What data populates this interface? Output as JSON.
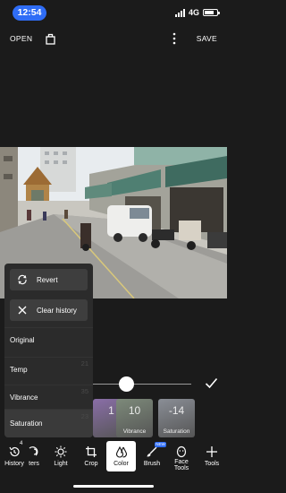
{
  "status_bar": {
    "time": "12:54",
    "network": "4G",
    "battery_level": 0.75
  },
  "top_bar": {
    "open_label": "OPEN",
    "save_label": "SAVE",
    "share_icon": "share-icon",
    "more_icon": "more-vertical-icon"
  },
  "photo": {
    "subject": "street-scene-photo"
  },
  "history_panel": {
    "revert_label": "Revert",
    "clear_label": "Clear history",
    "items": [
      {
        "label": "Original",
        "num": ""
      },
      {
        "label": "Temp",
        "num": "21"
      },
      {
        "label": "Vibrance",
        "num": "35"
      },
      {
        "label": "Saturation",
        "num": "23"
      }
    ],
    "selected_item": "Saturation"
  },
  "adjustment_slider": {
    "level": 0.34
  },
  "color_tiles": [
    {
      "value": "1",
      "label": "",
      "color": "#8a6ea8"
    },
    {
      "value": "10",
      "label": "Vibrance",
      "color": "#7d8a7a"
    },
    {
      "value": "-14",
      "label": "Saturation",
      "color": "#8a8e96"
    }
  ],
  "toolbar": {
    "tools": [
      {
        "label": "History",
        "icon": "history-icon"
      },
      {
        "label": "ters",
        "icon": "filters-icon"
      },
      {
        "label": "Light",
        "icon": "light-icon"
      },
      {
        "label": "Crop",
        "icon": "crop-icon"
      },
      {
        "label": "Color",
        "icon": "color-drop-icon"
      },
      {
        "label": "Brush",
        "icon": "brush-icon"
      },
      {
        "label": "Face Tools",
        "icon": "face-icon"
      },
      {
        "label": "Tools",
        "icon": "plus-icon"
      }
    ],
    "active_tool": "Color",
    "new_badge": "NEW",
    "history_count": "4"
  },
  "colors": {
    "accent": "#2f6df6",
    "background": "#1b1b1b",
    "panel": "#2b2b2b"
  }
}
